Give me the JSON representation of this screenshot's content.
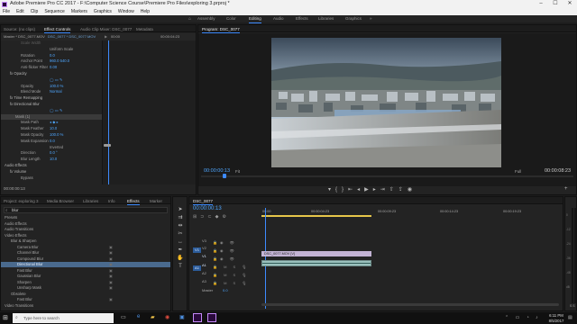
{
  "window": {
    "title": "Adobe Premiere Pro CC 2017 - F:\\Computer Science Course\\Premiere Pro Files\\exploring 3.prproj *",
    "minimize": "–",
    "maximize": "☐",
    "close": "✕"
  },
  "menu": [
    "File",
    "Edit",
    "Clip",
    "Sequence",
    "Markers",
    "Graphics",
    "Window",
    "Help"
  ],
  "workspaces": [
    {
      "label": "Assembly",
      "active": false
    },
    {
      "label": "Color",
      "active": false
    },
    {
      "label": "Editing",
      "active": true
    },
    {
      "label": "Audio",
      "active": false
    },
    {
      "label": "Effects",
      "active": false
    },
    {
      "label": "Libraries",
      "active": false
    },
    {
      "label": "Graphics",
      "active": false
    }
  ],
  "source_panel": {
    "tabs": [
      "Source: (no clips)",
      "Effect Controls",
      "Audio Clip Mixer: DSC_0077",
      "Metadata"
    ],
    "active_tab": 1,
    "header_master": "Master * DSC_0077.MOV",
    "header_clip": "DSC_0077 * DSC_0077.MOV",
    "header_time": "00:00",
    "header_time2": "00:00:04:23",
    "rows": [
      {
        "indent": 3,
        "label": "Scale Width",
        "value": "",
        "dim": true
      },
      {
        "indent": 3,
        "label": "",
        "value": "Uniform Scale",
        "check": true
      },
      {
        "indent": 3,
        "label": "Rotation",
        "value": "0.0"
      },
      {
        "indent": 3,
        "label": "Anchor Point",
        "value": "960.0    540.0"
      },
      {
        "indent": 3,
        "label": "Anti-flicker Filter",
        "value": "0.00"
      },
      {
        "indent": 1,
        "label": "fx  Opacity",
        "value": "",
        "section": true
      },
      {
        "indent": 2,
        "label": "",
        "value": "◯ ▭ ✎"
      },
      {
        "indent": 3,
        "label": "Opacity",
        "value": "100.0 %"
      },
      {
        "indent": 3,
        "label": "Blend Mode",
        "value": "Normal"
      },
      {
        "indent": 1,
        "label": "fx  Time Remapping",
        "value": "",
        "section": true
      },
      {
        "indent": 1,
        "label": "fx  Directional Blur",
        "value": "",
        "section": true
      },
      {
        "indent": 2,
        "label": "",
        "value": "◯ ▭ ✎"
      },
      {
        "indent": 2,
        "label": "Mask (1)",
        "value": "",
        "highlight": true
      },
      {
        "indent": 3,
        "label": "Mask Path",
        "value": "◂ ◆ ▸"
      },
      {
        "indent": 3,
        "label": "Mask Feather",
        "value": "10.0"
      },
      {
        "indent": 3,
        "label": "Mask Opacity",
        "value": "100.0 %"
      },
      {
        "indent": 3,
        "label": "Mask Expansion",
        "value": "0.0"
      },
      {
        "indent": 3,
        "label": "",
        "value": "Inverted",
        "check": true
      },
      {
        "indent": 3,
        "label": "Direction",
        "value": "0.0 °"
      },
      {
        "indent": 3,
        "label": "Blur Length",
        "value": "10.0"
      },
      {
        "indent": 0,
        "label": "Audio Effects",
        "value": "",
        "section": true
      },
      {
        "indent": 1,
        "label": "fx  Volume",
        "value": "",
        "section": true
      },
      {
        "indent": 3,
        "label": "Bypass",
        "value": ""
      }
    ],
    "footer_time": "00:00:00:13"
  },
  "program": {
    "tab": "Program: DSC_0077",
    "timecode": "00:00:00:13",
    "fit": "Fit",
    "quality": "Full",
    "duration": "00:00:08:23"
  },
  "project_panel": {
    "tabs": [
      "Project: exploring 3",
      "Media Browser",
      "Libraries",
      "Info",
      "Effects",
      "Marker"
    ],
    "active_tab": 4,
    "search_value": "blur",
    "tree": [
      {
        "indent": 0,
        "label": "Presets"
      },
      {
        "indent": 0,
        "label": "Audio Effects"
      },
      {
        "indent": 0,
        "label": "Audio Transitions"
      },
      {
        "indent": 0,
        "label": "Video Effects"
      },
      {
        "indent": 1,
        "label": "Blur & Sharpen"
      },
      {
        "indent": 2,
        "label": "Camera Blur"
      },
      {
        "indent": 2,
        "label": "Channel Blur"
      },
      {
        "indent": 2,
        "label": "Compound Blur"
      },
      {
        "indent": 2,
        "label": "Directional Blur",
        "selected": true
      },
      {
        "indent": 2,
        "label": "Fast Blur"
      },
      {
        "indent": 2,
        "label": "Gaussian Blur"
      },
      {
        "indent": 2,
        "label": "Sharpen"
      },
      {
        "indent": 2,
        "label": "Unsharp Mask"
      },
      {
        "indent": 1,
        "label": "Obsolete"
      },
      {
        "indent": 2,
        "label": "Fast Blur"
      },
      {
        "indent": 0,
        "label": "Video Transitions"
      }
    ]
  },
  "timeline": {
    "tab": "DSC_0077",
    "timecode": "00:00:00:13",
    "ruler": [
      "00:00",
      "00:00:04:23",
      "00:00:09:23",
      "00:00:14:23",
      "00:00:19:23"
    ],
    "tracks": [
      {
        "name": "V3"
      },
      {
        "name": "V2"
      },
      {
        "name": "V1"
      },
      {
        "name": "A1"
      },
      {
        "name": "A2"
      },
      {
        "name": "A3"
      }
    ],
    "src_v1": "V1",
    "src_a1": "A1",
    "master": "Master",
    "master_val": "0.0",
    "video_clip": "DSC_0077.MOV [V]",
    "audio_clip": "",
    "meter_labels": [
      "0",
      "-12",
      "-24",
      "-36",
      "-48",
      "dB"
    ],
    "meter_solo": "S S"
  },
  "taskbar": {
    "search_placeholder": "Type here to search",
    "time": "6:11 PM",
    "date": "8/5/2017"
  },
  "colors": {
    "accent": "#3d8bff",
    "selection": "#4a6a8e"
  }
}
